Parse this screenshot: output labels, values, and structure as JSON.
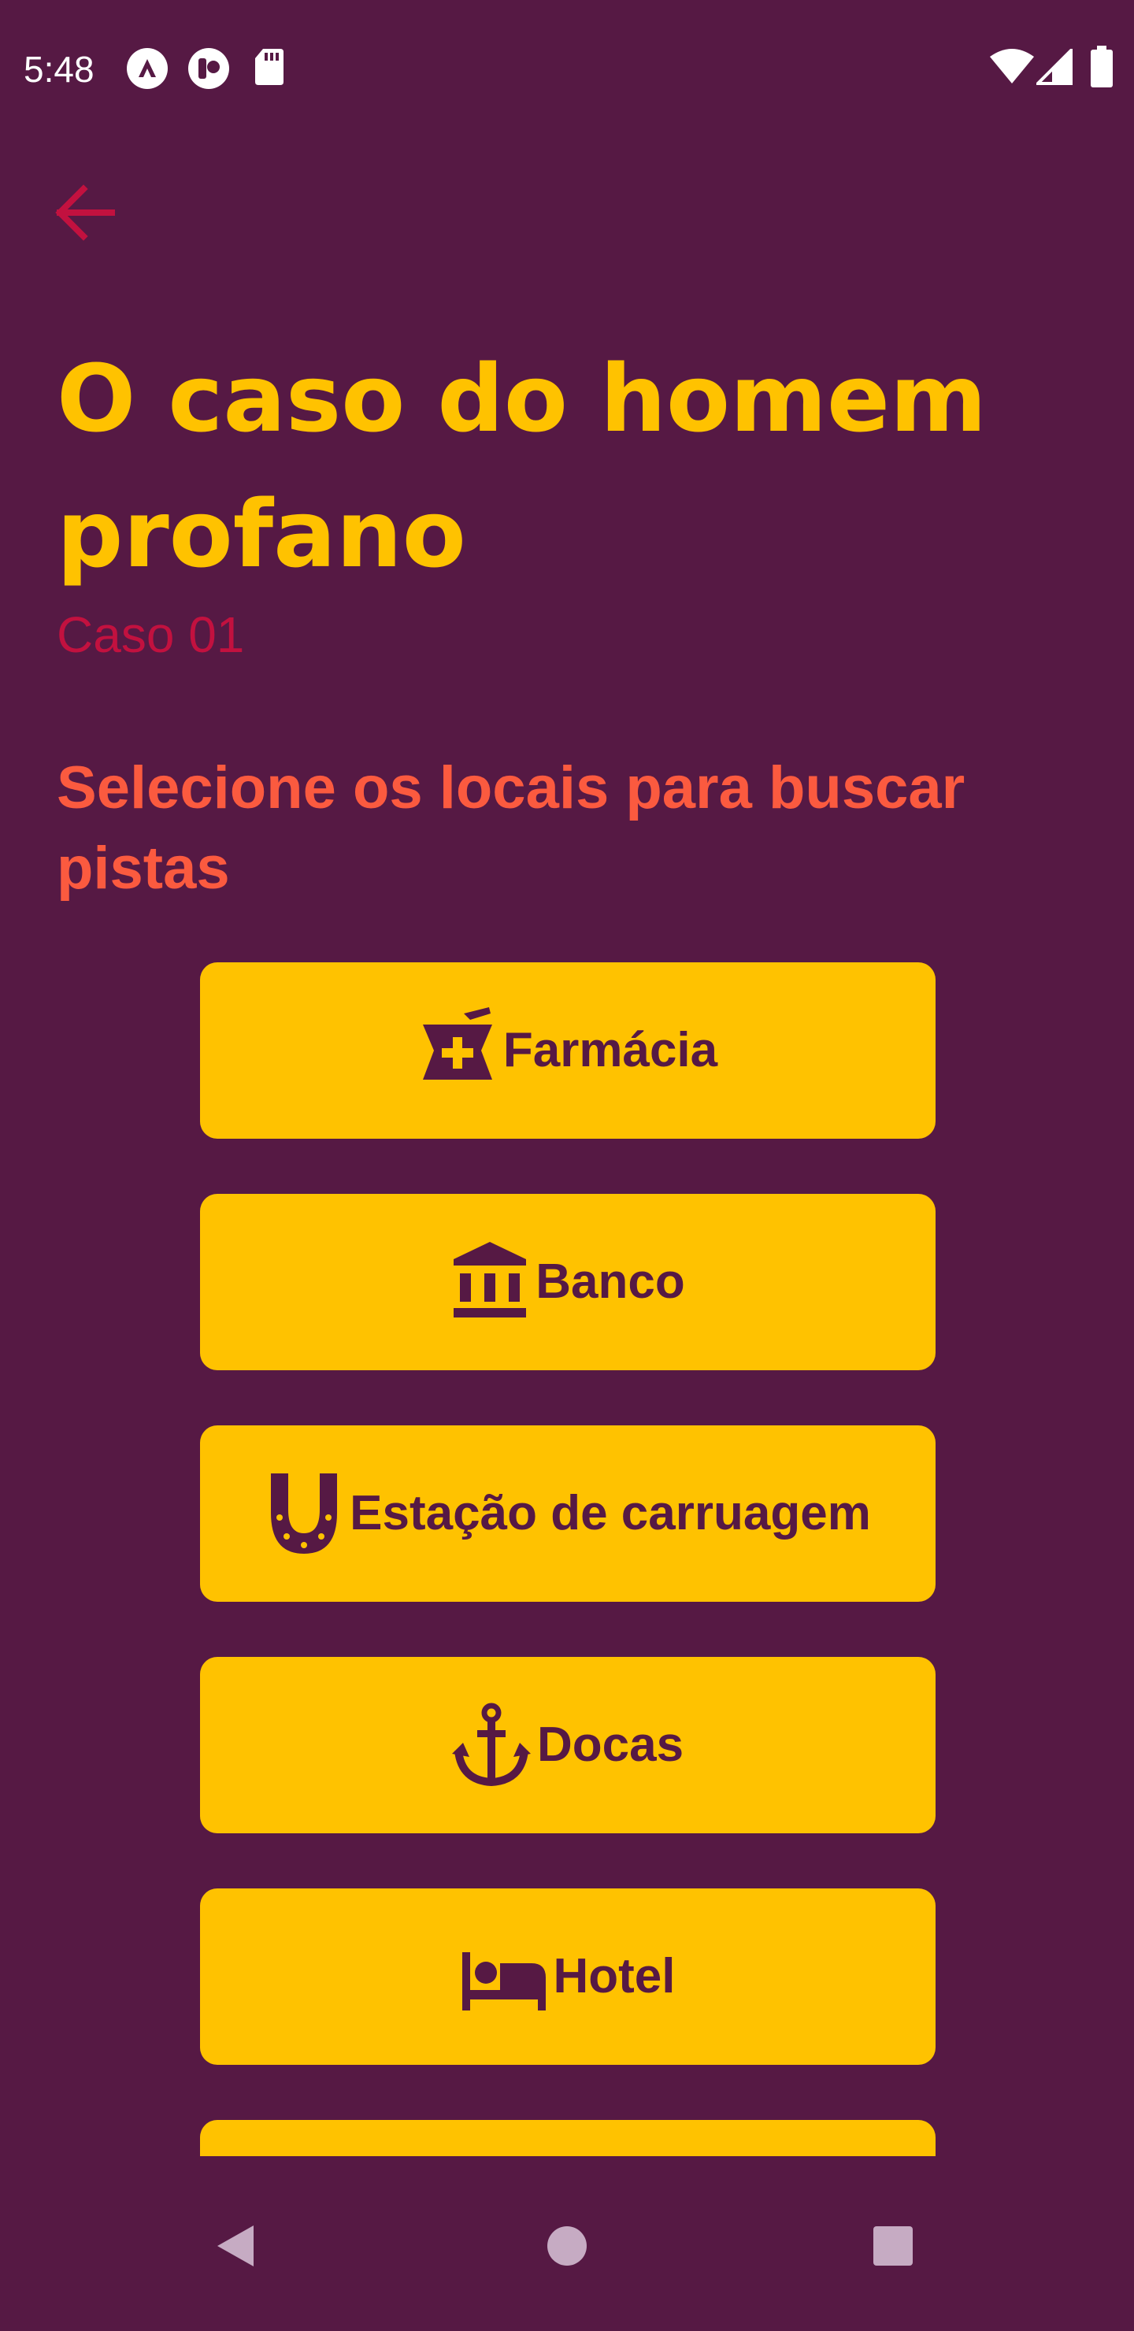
{
  "status_bar": {
    "time": "5:48",
    "left_icons": [
      "app-a-icon",
      "app-circle-icon",
      "sd-card-icon"
    ],
    "right_icons": [
      "wifi-icon",
      "cell-signal-icon",
      "battery-icon"
    ]
  },
  "header": {
    "back_icon": "arrow-left-icon",
    "title": "O caso do homem profano",
    "subtitle": "Caso 01"
  },
  "instruction": "Selecione os locais para buscar pistas",
  "places": [
    {
      "label": "Farmácia",
      "icon": "pharmacy-mortar-icon"
    },
    {
      "label": "Banco",
      "icon": "bank-icon"
    },
    {
      "label": "Estação de carruagem",
      "icon": "horseshoe-icon"
    },
    {
      "label": "Docas",
      "icon": "anchor-icon"
    },
    {
      "label": "Hotel",
      "icon": "bed-icon"
    },
    {
      "label": "",
      "icon": ""
    }
  ],
  "nav_bar": {
    "back": "nav-back-icon",
    "home": "nav-home-icon",
    "recents": "nav-recents-icon"
  },
  "colors": {
    "background": "#561944",
    "title": "#ffc200",
    "subtitle": "#c2113f",
    "instruction": "#fb5a3f",
    "button": "#ffc200",
    "button_text": "#561944"
  }
}
